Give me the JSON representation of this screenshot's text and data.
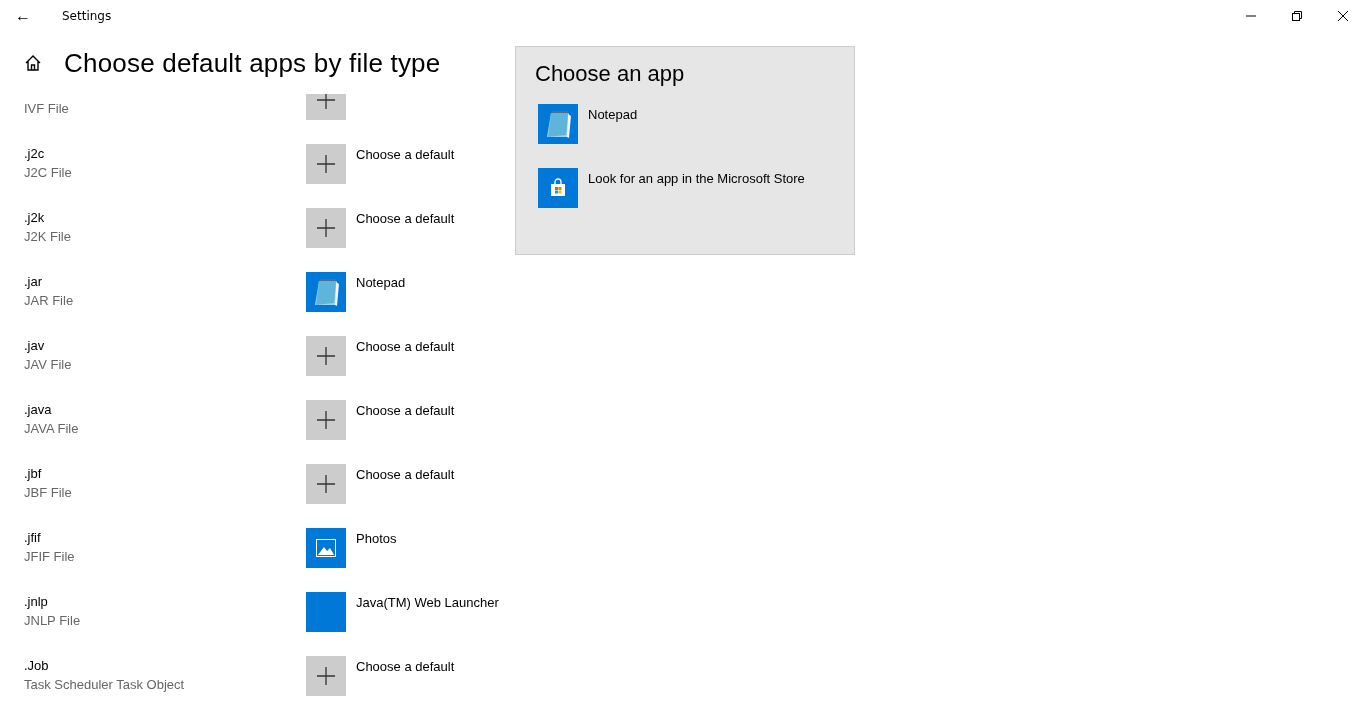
{
  "window": {
    "title": "Settings",
    "back": "←"
  },
  "page": {
    "title": "Choose default apps by file type"
  },
  "file_types": [
    {
      "description": "IVF File",
      "app": {
        "kind": "plus"
      }
    },
    {
      "extension": ".j2c",
      "description": "J2C File",
      "app": {
        "kind": "plus",
        "name": "Choose a default"
      }
    },
    {
      "extension": ".j2k",
      "description": "J2K File",
      "app": {
        "kind": "plus",
        "name": "Choose a default"
      }
    },
    {
      "extension": ".jar",
      "description": "JAR File",
      "app": {
        "kind": "notepad",
        "name": "Notepad"
      }
    },
    {
      "extension": ".jav",
      "description": "JAV File",
      "app": {
        "kind": "plus",
        "name": "Choose a default"
      }
    },
    {
      "extension": ".java",
      "description": "JAVA File",
      "app": {
        "kind": "plus",
        "name": "Choose a default"
      }
    },
    {
      "extension": ".jbf",
      "description": "JBF File",
      "app": {
        "kind": "plus",
        "name": "Choose a default"
      }
    },
    {
      "extension": ".jfif",
      "description": "JFIF File",
      "app": {
        "kind": "photos",
        "name": "Photos"
      }
    },
    {
      "extension": ".jnlp",
      "description": "JNLP File",
      "app": {
        "kind": "blank",
        "name": "Java(TM) Web Launcher"
      }
    },
    {
      "extension": ".Job",
      "description": "Task Scheduler Task Object",
      "app": {
        "kind": "plus",
        "name": "Choose a default"
      }
    }
  ],
  "flyout": {
    "title": "Choose an app",
    "items": [
      {
        "kind": "notepad",
        "label": "Notepad"
      },
      {
        "kind": "store",
        "label": "Look for an app in the Microsoft Store"
      }
    ]
  }
}
